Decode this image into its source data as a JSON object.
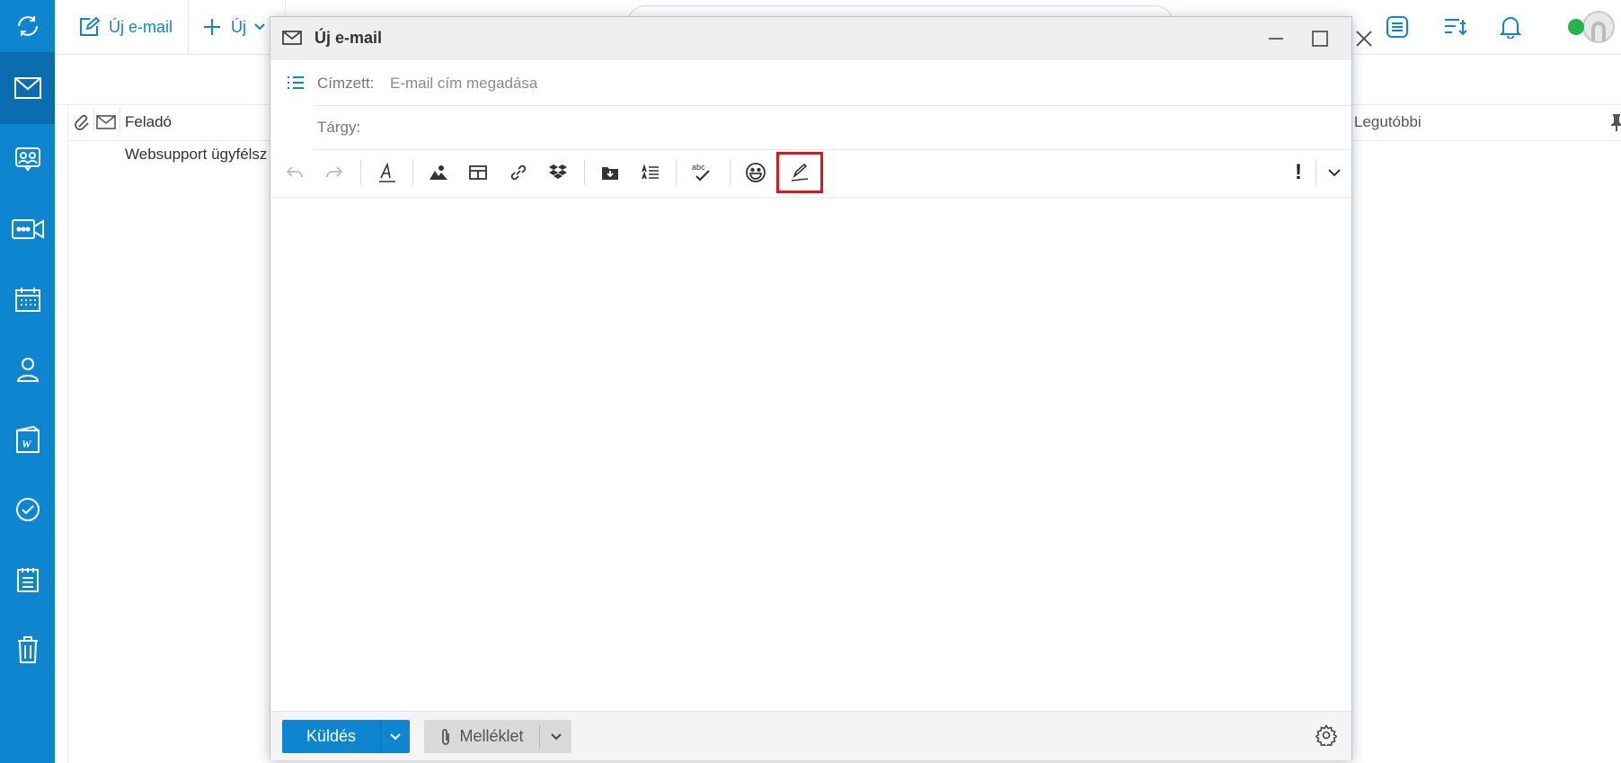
{
  "topbar": {
    "new_email_label": "Új e-mail",
    "new_label": "Új"
  },
  "message_list": {
    "column_sender": "Feladó",
    "sort_label": "Legutóbbi",
    "rows": [
      {
        "sender": "Websupport ügyfélsz"
      }
    ]
  },
  "compose": {
    "title": "Új e-mail",
    "to_label": "Címzett:",
    "to_placeholder": "E-mail cím megadása",
    "subject_label": "Tárgy:",
    "priority_label": "!",
    "send_label": "Küldés",
    "attach_label": "Melléklet"
  },
  "colors": {
    "accent": "#0e86cf",
    "highlight": "#e0141d",
    "presence": "#25b34b"
  }
}
